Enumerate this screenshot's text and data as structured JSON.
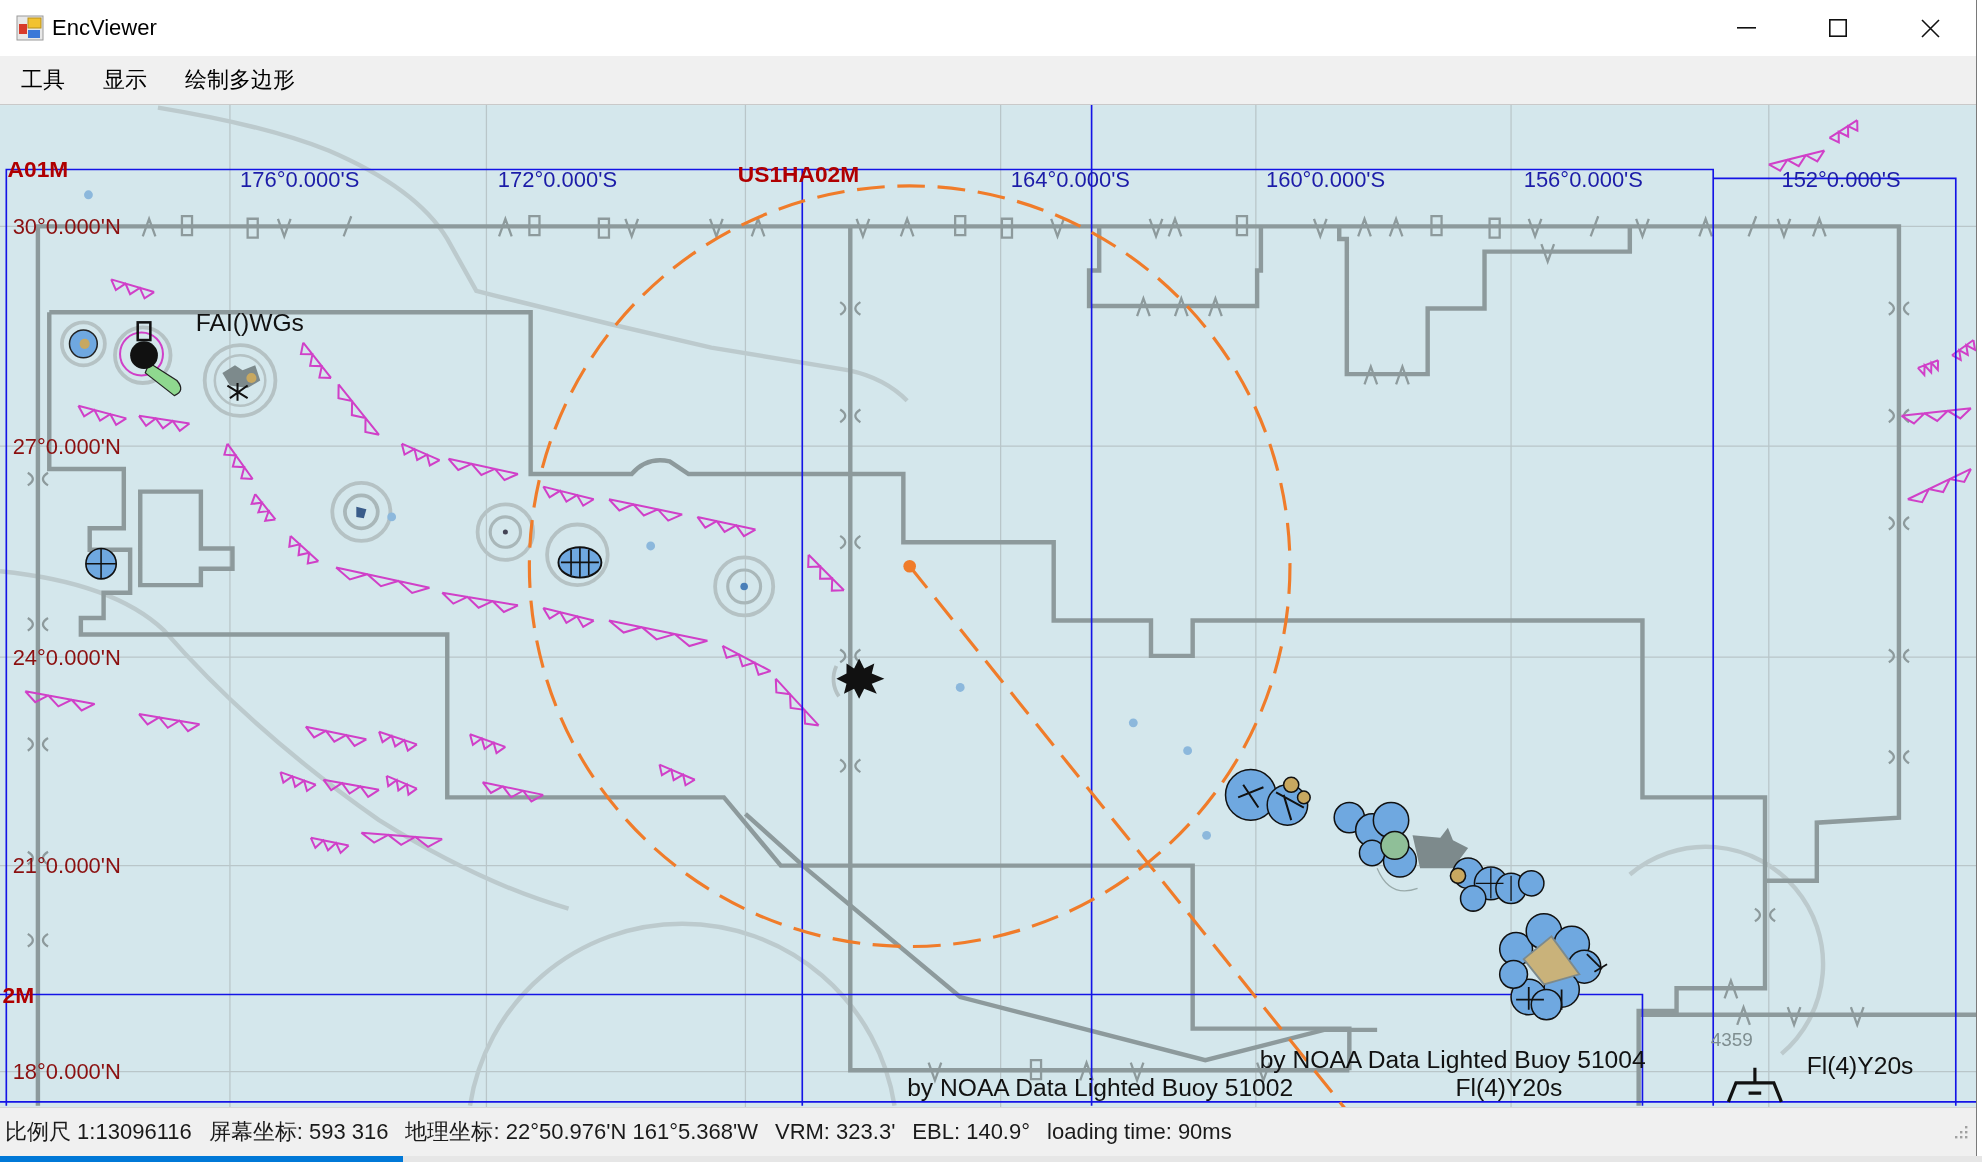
{
  "window": {
    "title": "EncViewer"
  },
  "menu": [
    "工具",
    "显示",
    "绘制多边形"
  ],
  "chart_view": {
    "cell_labels": [
      "A01M",
      "US1HA02M",
      "2M"
    ],
    "longitude_labels": [
      "176°0.000'S",
      "172°0.000'S",
      "164°0.000'S",
      "160°0.000'S",
      "156°0.000'S",
      "152°0.000'S"
    ],
    "latitude_labels": [
      "30°0.000'N",
      "27°0.000'N",
      "24°0.000'N",
      "21°0.000'N",
      "18°0.000'N"
    ],
    "feature_labels": [
      "FAI()WGs",
      "4359",
      "by NOAA Data Lighted Buoy 51004",
      "Fl(4)Y20s",
      "by NOAA Data Lighted Buoy 51002",
      "Fl(4)Y20s"
    ]
  },
  "status_bar": {
    "items": [
      "比例尺 1:13096116",
      "屏幕坐标: 593 316",
      "地理坐标: 22°50.976'N 161°5.368'W",
      "VRM: 323.3'",
      "EBL: 140.9°",
      "loading time: 90ms"
    ]
  }
}
